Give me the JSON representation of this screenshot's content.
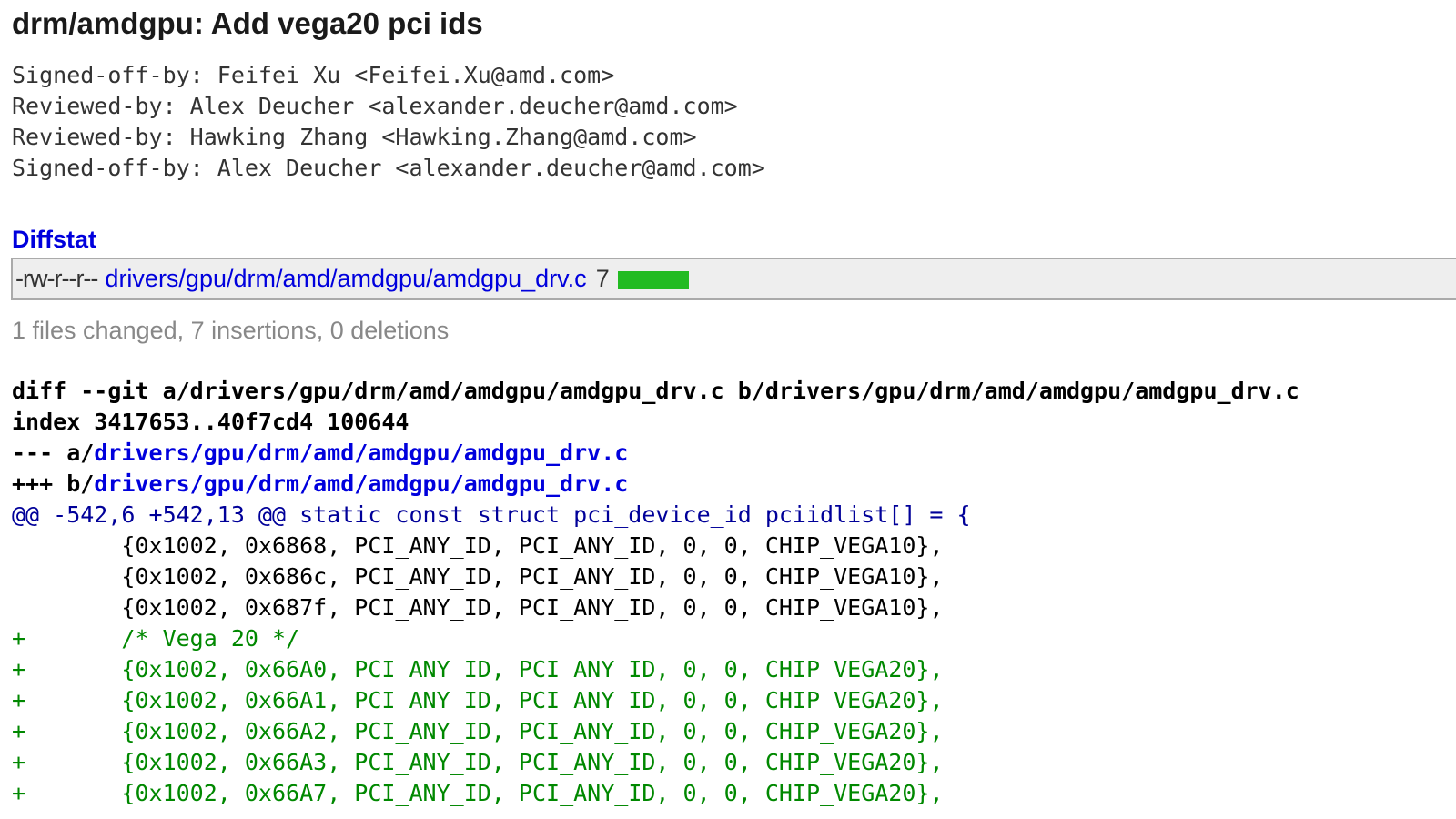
{
  "commit": {
    "title": "drm/amdgpu: Add vega20 pci ids",
    "message_lines": [
      "Signed-off-by: Feifei Xu <Feifei.Xu@amd.com>",
      "Reviewed-by: Alex Deucher <alexander.deucher@amd.com>",
      "Reviewed-by: Hawking Zhang <Hawking.Zhang@amd.com>",
      "Signed-off-by: Alex Deucher <alexander.deucher@amd.com>"
    ]
  },
  "diffstat": {
    "header": "Diffstat",
    "row": {
      "mode": "-rw-r--r--",
      "file": "drivers/gpu/drm/amd/amdgpu/amdgpu_drv.c",
      "count": "7",
      "insertions_fraction": 1.0
    },
    "summary": "1 files changed, 7 insertions, 0 deletions"
  },
  "diff": {
    "git_line": "diff --git a/drivers/gpu/drm/amd/amdgpu/amdgpu_drv.c b/drivers/gpu/drm/amd/amdgpu/amdgpu_drv.c",
    "index_line": "index 3417653..40f7cd4 100644",
    "old_prefix": "--- a/",
    "old_path": "drivers/gpu/drm/amd/amdgpu/amdgpu_drv.c",
    "new_prefix": "+++ b/",
    "new_path": "drivers/gpu/drm/amd/amdgpu/amdgpu_drv.c",
    "hunk": "@@ -542,6 +542,13 @@ static const struct pci_device_id pciidlist[] = {",
    "lines": [
      " \t{0x1002, 0x6868, PCI_ANY_ID, PCI_ANY_ID, 0, 0, CHIP_VEGA10},",
      " \t{0x1002, 0x686c, PCI_ANY_ID, PCI_ANY_ID, 0, 0, CHIP_VEGA10},",
      " \t{0x1002, 0x687f, PCI_ANY_ID, PCI_ANY_ID, 0, 0, CHIP_VEGA10},",
      "+\t/* Vega 20 */",
      "+\t{0x1002, 0x66A0, PCI_ANY_ID, PCI_ANY_ID, 0, 0, CHIP_VEGA20},",
      "+\t{0x1002, 0x66A1, PCI_ANY_ID, PCI_ANY_ID, 0, 0, CHIP_VEGA20},",
      "+\t{0x1002, 0x66A2, PCI_ANY_ID, PCI_ANY_ID, 0, 0, CHIP_VEGA20},",
      "+\t{0x1002, 0x66A3, PCI_ANY_ID, PCI_ANY_ID, 0, 0, CHIP_VEGA20},",
      "+\t{0x1002, 0x66A7, PCI_ANY_ID, PCI_ANY_ID, 0, 0, CHIP_VEGA20},"
    ]
  },
  "colors": {
    "link": "#0000dd",
    "added": "#008800",
    "hunk": "#000099",
    "diffstat_bar": "#22bb22"
  }
}
